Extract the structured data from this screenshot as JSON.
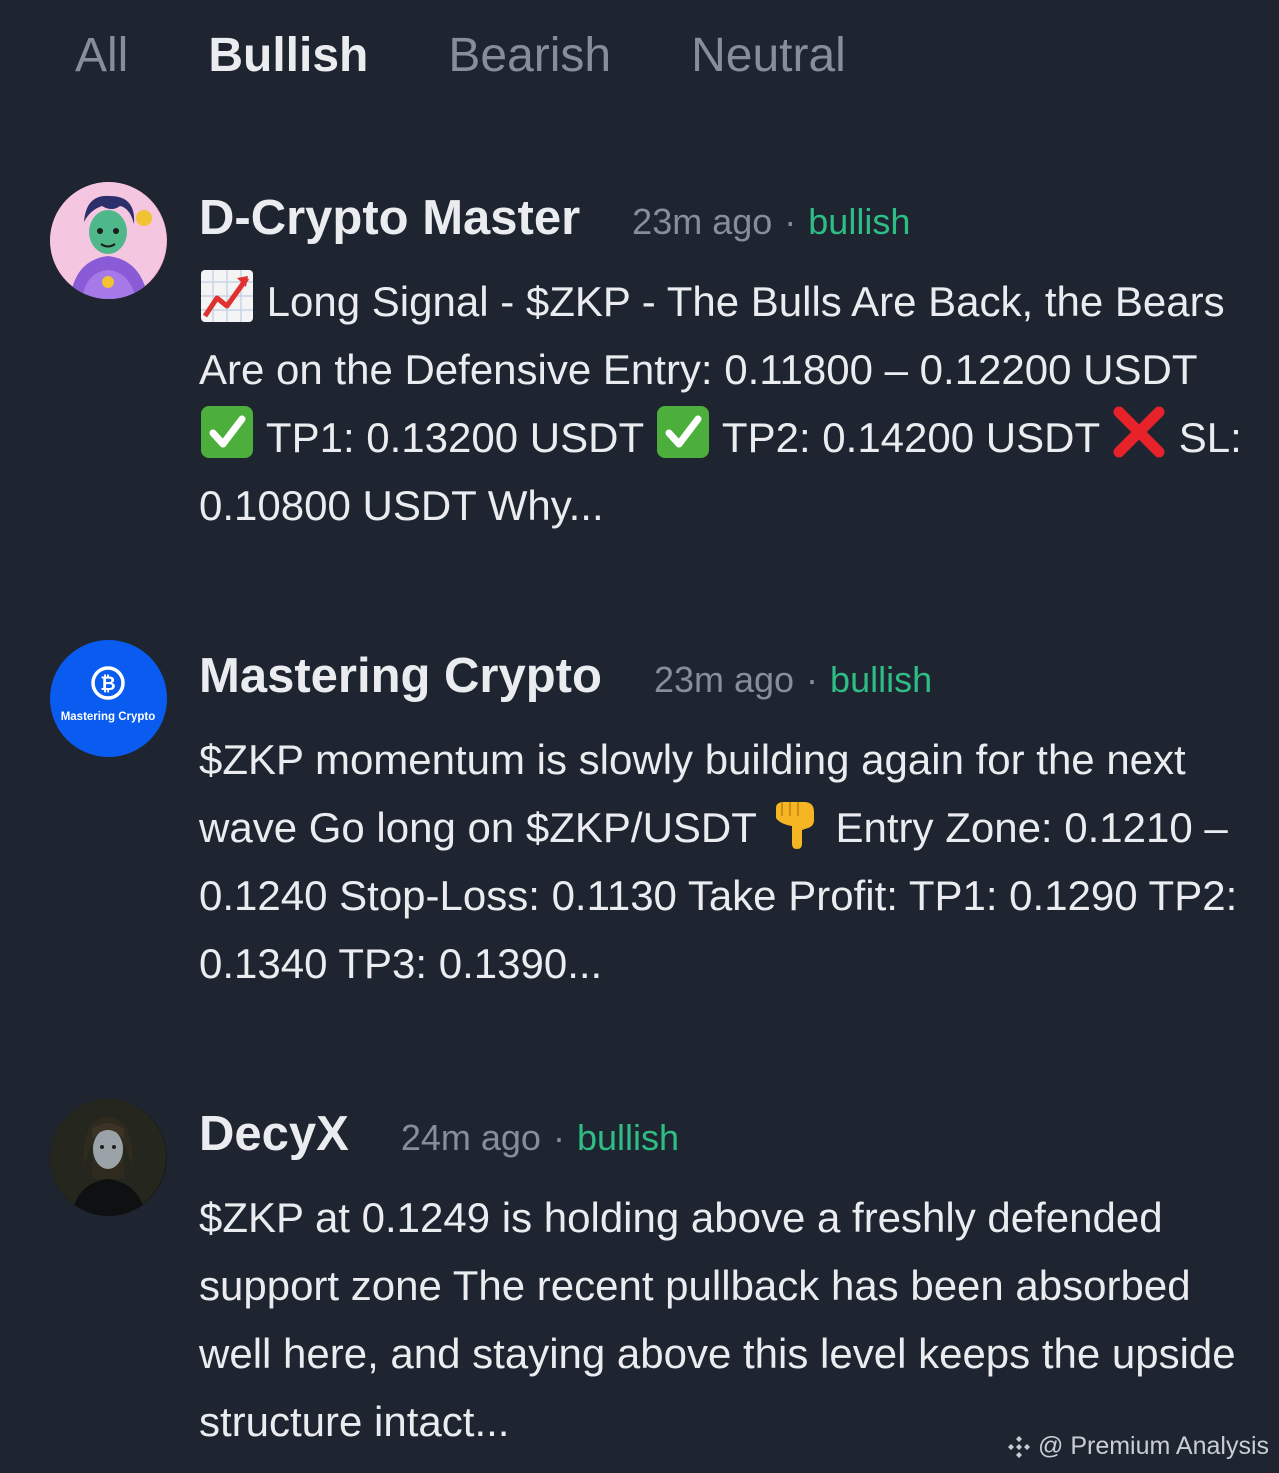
{
  "tabs": [
    {
      "label": "All",
      "active": false
    },
    {
      "label": "Bullish",
      "active": true
    },
    {
      "label": "Bearish",
      "active": false
    },
    {
      "label": "Neutral",
      "active": false
    }
  ],
  "posts": [
    {
      "author": "D-Crypto Master",
      "time": "23m ago",
      "separator": "·",
      "sentiment": "bullish",
      "body": [
        {
          "emoji": "chart-increasing-icon"
        },
        {
          "text": " Long Signal - $ZKP - The Bulls Are Back, the Bears Are on the Defensive Entry: 0.11800 – 0.12200 USDT "
        },
        {
          "emoji": "check-mark-icon"
        },
        {
          "text": " TP1: 0.13200 USDT "
        },
        {
          "emoji": "check-mark-icon"
        },
        {
          "text": " TP2: 0.14200 USDT "
        },
        {
          "emoji": "cross-mark-icon"
        },
        {
          "text": " SL: 0.10800 USDT Why..."
        }
      ]
    },
    {
      "author": "Mastering Crypto",
      "avatar_text": "Mastering Crypto",
      "avatar_symbol": "₿",
      "time": "23m ago",
      "separator": "·",
      "sentiment": "bullish",
      "body": [
        {
          "text": "$ZKP momentum is slowly building again for the next wave Go long on $ZKP/USDT "
        },
        {
          "emoji": "pointing-down-hand-icon"
        },
        {
          "text": " Entry Zone: 0.1210 – 0.1240 Stop-Loss: 0.1130 Take Profit: TP1: 0.1290 TP2: 0.1340 TP3: 0.1390..."
        }
      ]
    },
    {
      "author": "DecyX",
      "time": "24m ago",
      "separator": "·",
      "sentiment": "bullish",
      "body": [
        {
          "text": "$ZKP at 0.1249 is holding above a freshly defended support zone The recent pullback has been absorbed well here, and staying above this level keeps the upside structure intact..."
        }
      ]
    }
  ],
  "watermark": "@ Premium Analysis",
  "colors": {
    "background": "#1e2530",
    "text_primary": "#eaecef",
    "text_secondary": "#848e9c",
    "bullish": "#2ebd85"
  }
}
